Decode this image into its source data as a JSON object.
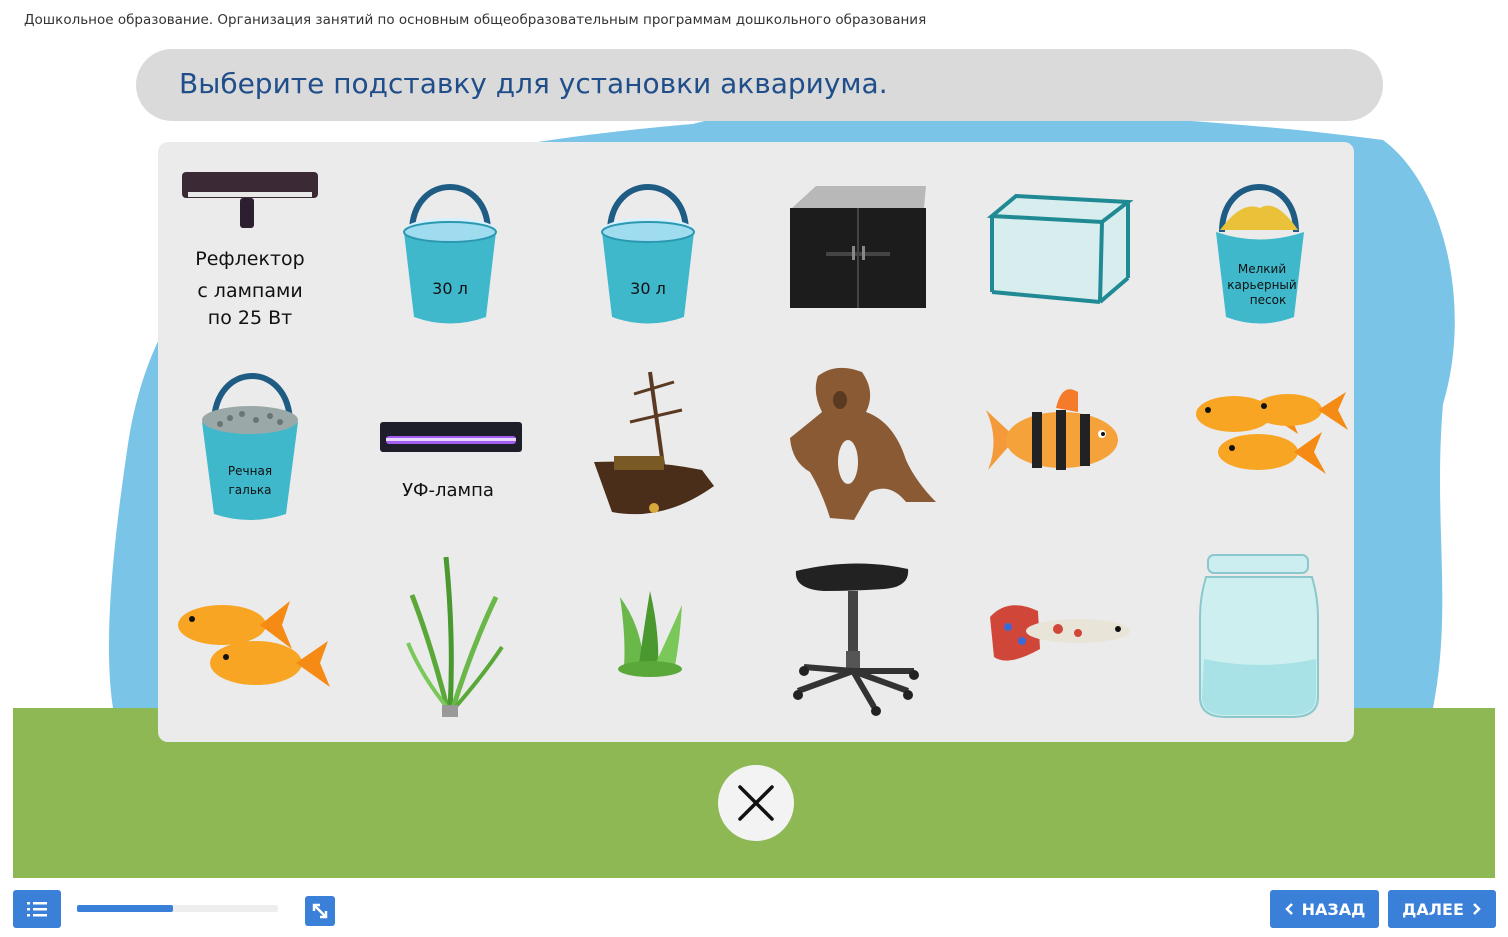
{
  "course_title": "Дошкольное образование. Организация занятий по основным общеобразовательным программам дошкольного образования",
  "question": "Выберите подставку для установки аквариума.",
  "items": {
    "reflector": {
      "label_lines": [
        "Рефлектор",
        "с лампами",
        "по 25 Вт"
      ]
    },
    "bucket_1": {
      "label": "30 л"
    },
    "bucket_2": {
      "label": "30 л"
    },
    "sand_bucket": {
      "label_lines": [
        "Мелкий",
        "карьерный",
        "песок"
      ]
    },
    "pebble_bucket": {
      "label_lines": [
        "Речная",
        "галька"
      ]
    },
    "uv_lamp": {
      "label": "УФ-лампа"
    }
  },
  "progress": {
    "fraction": 0.48
  },
  "nav": {
    "back_label": "НАЗАД",
    "next_label": "ДАЛЕЕ"
  },
  "colors": {
    "accent": "#3a7fd8",
    "question_text": "#1f4e8a",
    "grass": "#8eb854",
    "sky_blob": "#7ac4e8",
    "bucket": "#3fb8cc"
  },
  "icons": {
    "toc": "list-icon",
    "expand": "expand-icon",
    "close": "close-icon",
    "back": "chevron-left-icon",
    "next": "chevron-right-icon"
  }
}
